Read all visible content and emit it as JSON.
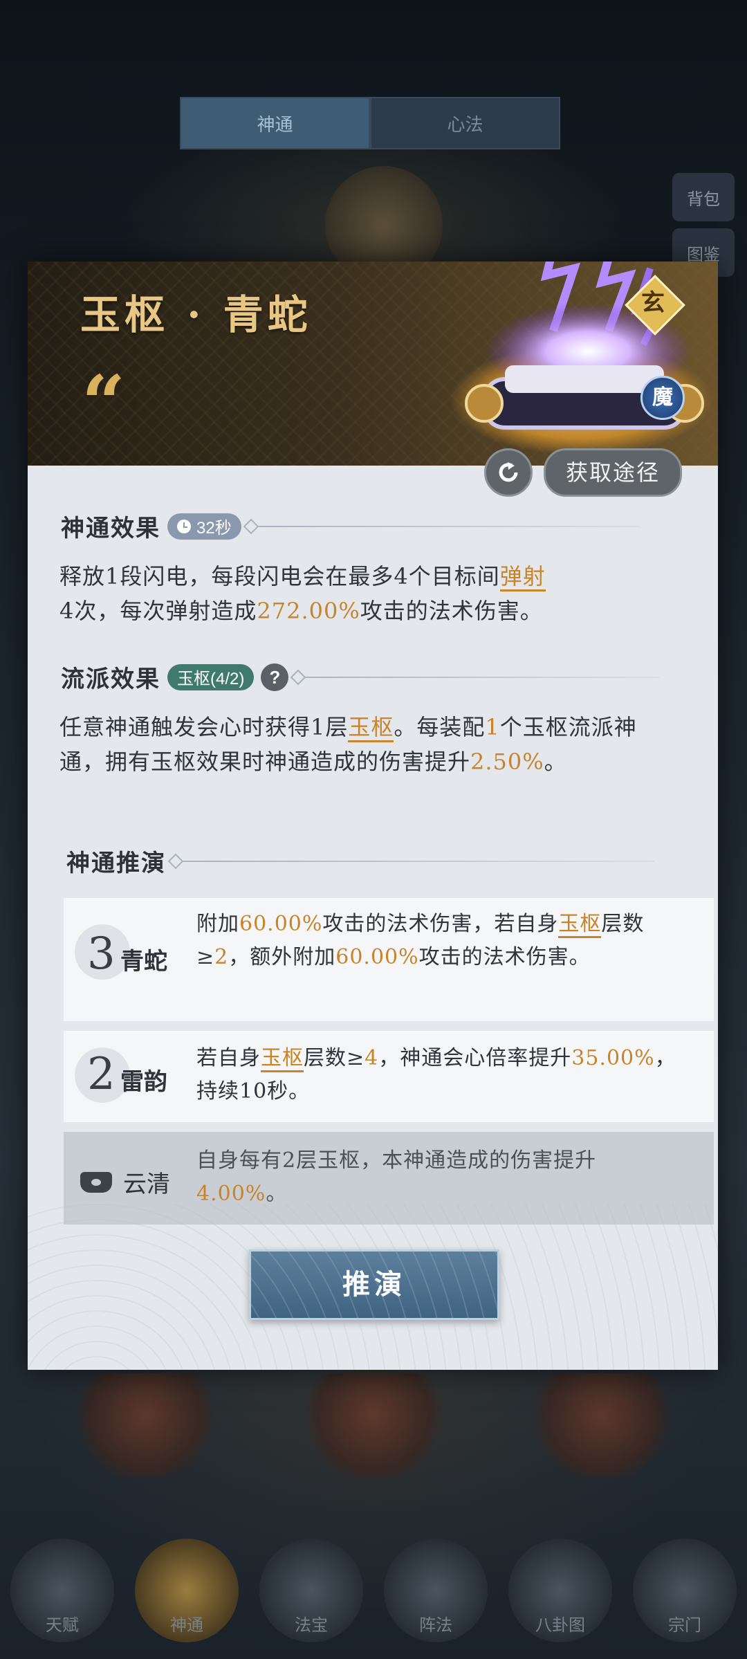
{
  "background": {
    "tabs": [
      "神通",
      "心法"
    ],
    "side_labels": [
      "背包",
      "图鉴"
    ],
    "nav_labels": [
      "天赋",
      "神通",
      "法宝",
      "阵法",
      "八卦图",
      "宗门"
    ]
  },
  "panel": {
    "title": "玉枢 · 青蛇",
    "quote_mark": "“",
    "grade": "玄",
    "type_badge": "魔",
    "acquire_label": "获取途径",
    "effect": {
      "heading": "神通效果",
      "cooldown": "32秒",
      "text_segments": [
        "释放1段闪电，每段闪电会在最多4个目标间",
        "弹射",
        "4次，每次弹射造成",
        "272.00%",
        "攻击的法术伤害。"
      ]
    },
    "school": {
      "heading": "流派效果",
      "tag": "玉枢(4/2)",
      "help": "?",
      "text_segments": [
        "任意神通触发会心时获得1层",
        "玉枢",
        "。每装配",
        "1",
        "个玉枢流派神通，拥有玉枢效果时神通造成的伤害提升",
        "2.50%",
        "。"
      ]
    },
    "deduce": {
      "heading": "神通推演",
      "rows": [
        {
          "level": "3",
          "name": "青蛇",
          "segments": [
            "附加",
            "60.00%",
            "攻击的法术伤害，若自身",
            "玉枢",
            "层数≥",
            "2",
            "，额外附加",
            "60.00%",
            "攻击的法术伤害。"
          ]
        },
        {
          "level": "2",
          "name": "雷韵",
          "segments": [
            "若自身",
            "玉枢",
            "层数≥",
            "4",
            "，神通会心倍率提升",
            "35.00%",
            "，持续10秒。"
          ]
        },
        {
          "level": "",
          "name": "云清",
          "segments": [
            "自身每有2层玉枢，本神通造成的伤害提升",
            "4.00%",
            "。"
          ]
        }
      ],
      "button_label": "推演"
    }
  }
}
